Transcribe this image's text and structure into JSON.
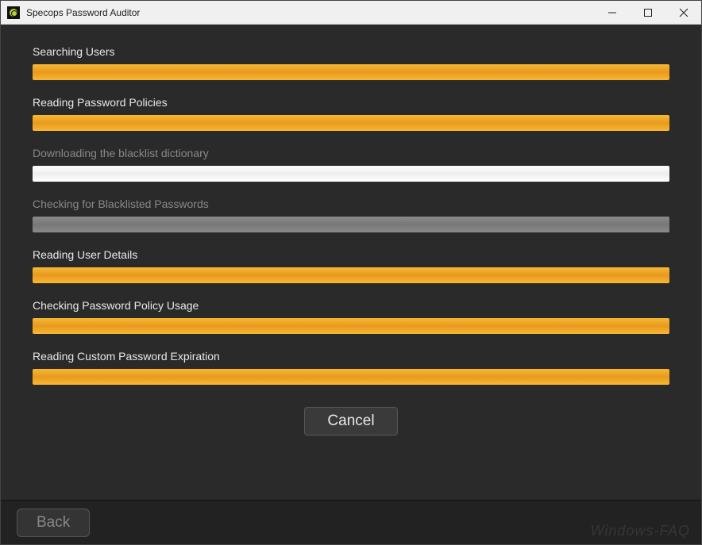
{
  "window": {
    "title": "Specops Password Auditor"
  },
  "tasks": [
    {
      "label": "Searching Users",
      "active": true,
      "bar_style": "orange",
      "progress": 100
    },
    {
      "label": "Reading Password Policies",
      "active": true,
      "bar_style": "orange",
      "progress": 100
    },
    {
      "label": "Downloading the blacklist dictionary",
      "active": false,
      "bar_style": "white",
      "progress": 100
    },
    {
      "label": "Checking for Blacklisted Passwords",
      "active": false,
      "bar_style": "grey",
      "progress": 100
    },
    {
      "label": "Reading User Details",
      "active": true,
      "bar_style": "orange",
      "progress": 100
    },
    {
      "label": "Checking Password Policy Usage",
      "active": true,
      "bar_style": "orange",
      "progress": 100
    },
    {
      "label": "Reading Custom Password Expiration",
      "active": true,
      "bar_style": "orange",
      "progress": 100
    }
  ],
  "buttons": {
    "cancel": "Cancel",
    "back": "Back"
  },
  "watermark": "Windows-FAQ"
}
